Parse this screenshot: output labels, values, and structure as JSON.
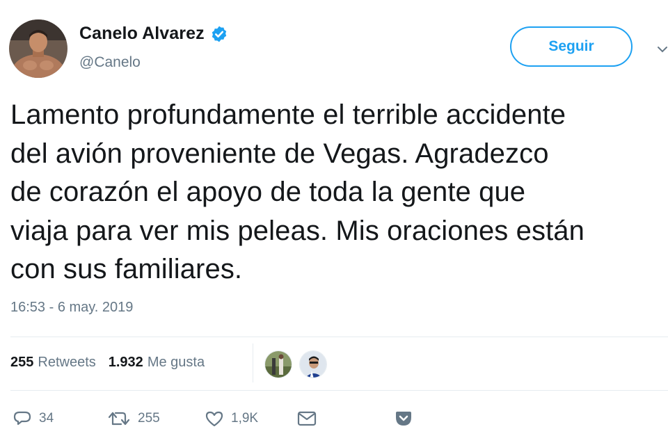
{
  "user": {
    "display_name": "Canelo Alvarez",
    "handle": "@Canelo",
    "verified": true
  },
  "follow_button": {
    "label": "Seguir"
  },
  "tweet": {
    "lines": [
      "Lamento profundamente el terrible accidente",
      "del avión proveniente de Vegas. Agradezco",
      "de corazón el apoyo de toda la gente que",
      "viaja para ver mis peleas. Mis oraciones están",
      "con sus familiares."
    ],
    "timestamp": "16:53 - 6 may. 2019"
  },
  "stats": {
    "retweets_count": "255",
    "retweets_label": "Retweets",
    "likes_count": "1.932",
    "likes_label": "Me gusta"
  },
  "actions": {
    "reply_count": "34",
    "retweet_count": "255",
    "like_count": "1,9K"
  },
  "icons": [
    "verified-icon",
    "chevron-down-icon",
    "reply-icon",
    "retweet-icon",
    "heart-icon",
    "envelope-icon",
    "pocket-icon"
  ],
  "colors": {
    "accent": "#1da1f2",
    "text": "#14171a",
    "secondary": "#657786",
    "divider": "#e6ecf0"
  }
}
